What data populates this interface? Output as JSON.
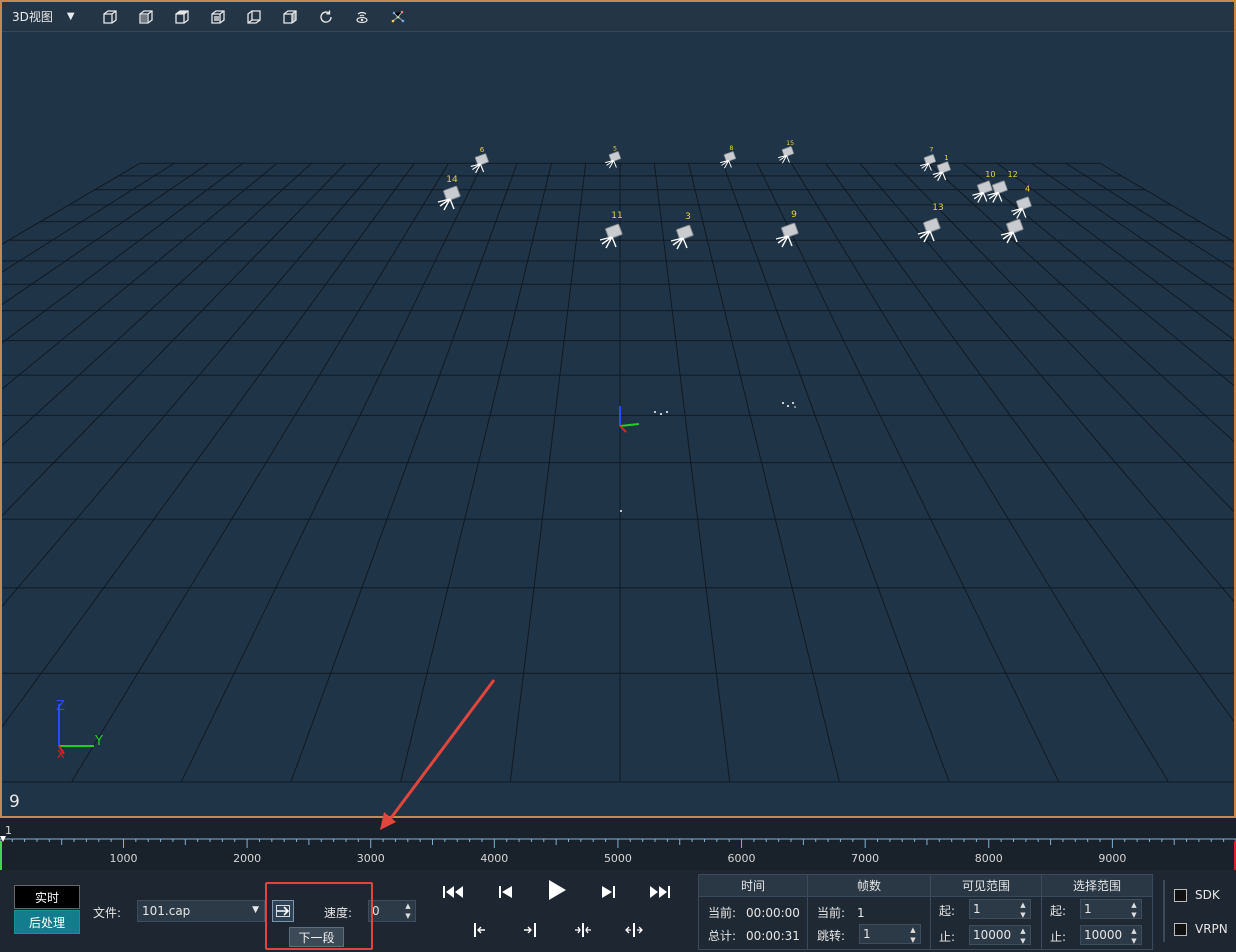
{
  "toolbar": {
    "view_label": "3D视图",
    "icons": [
      "cube-front-icon",
      "cube-side-icon",
      "cube-top-icon",
      "cube-iso-icon",
      "cube-back-icon",
      "cube-right-icon",
      "refresh-icon",
      "wifi-device-icon",
      "marker-cloud-icon"
    ]
  },
  "viewport": {
    "frame_number": "9",
    "axis_labels": {
      "z": "Z",
      "y": "Y",
      "x": "X"
    },
    "cameras": [
      {
        "id": "14",
        "label": "14"
      },
      {
        "id": "6",
        "label": "6"
      },
      {
        "id": "5",
        "label": "5"
      },
      {
        "id": "8",
        "label": "8"
      },
      {
        "id": "15",
        "label": "15"
      },
      {
        "id": "7",
        "label": "7"
      },
      {
        "id": "1",
        "label": "1"
      },
      {
        "id": "10",
        "label": "10"
      },
      {
        "id": "12",
        "label": "12"
      },
      {
        "id": "4",
        "label": "4"
      },
      {
        "id": "11",
        "label": "11"
      },
      {
        "id": "3",
        "label": "3"
      },
      {
        "id": "9",
        "label": "9"
      },
      {
        "id": "13",
        "label": "13"
      },
      {
        "id": "2",
        "label": ""
      }
    ],
    "colors": {
      "background": "#203447",
      "grid": "#0f1a24",
      "camera_label": "#e8d23a",
      "border": "#c8874c"
    }
  },
  "timeline": {
    "start_label": "1",
    "tick_labels": [
      "1000",
      "2000",
      "3000",
      "4000",
      "5000",
      "6000",
      "7000",
      "8000",
      "9000"
    ],
    "range": [
      1,
      10000
    ],
    "current_frame": 1
  },
  "controls": {
    "realtime_label": "实时",
    "post_label": "后处理",
    "file_label": "文件:",
    "file_value": "101.cap",
    "speed_label": "速度:",
    "speed_value": "0",
    "next_segment_tooltip": "下一段"
  },
  "stats": {
    "time": {
      "header": "时间",
      "current_label": "当前:",
      "current_value": "00:00:00",
      "total_label": "总计:",
      "total_value": "00:00:31"
    },
    "frames": {
      "header": "帧数",
      "current_label": "当前:",
      "current_value": "1",
      "jump_label": "跳转:",
      "jump_value": "1"
    },
    "visible_range": {
      "header": "可见范围",
      "start_label": "起:",
      "start_value": "1",
      "end_label": "止:",
      "end_value": "10000"
    },
    "select_range": {
      "header": "选择范围",
      "start_label": "起:",
      "start_value": "1",
      "end_label": "止:",
      "end_value": "10000"
    }
  },
  "outputs": {
    "sdk_label": "SDK",
    "vrpn_label": "VRPN"
  }
}
